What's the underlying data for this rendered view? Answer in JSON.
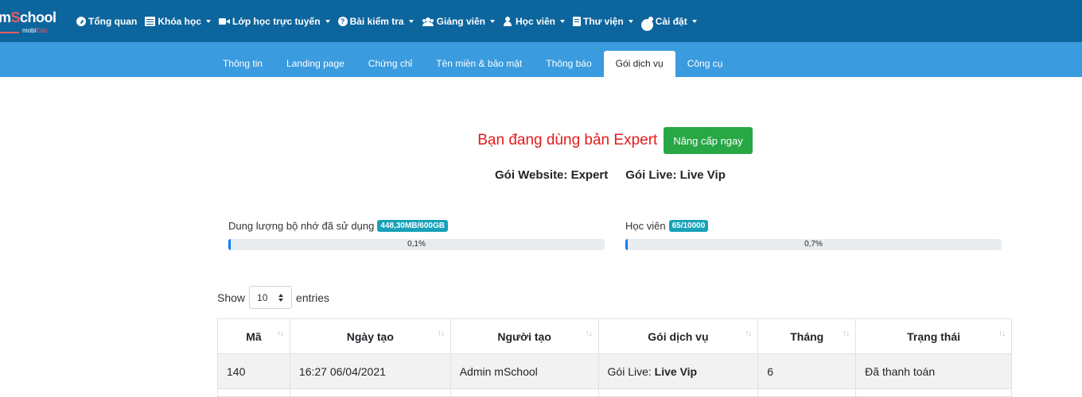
{
  "brand": {
    "name_prefix": "m",
    "name_highlight": "S",
    "name_suffix": "chool",
    "sub_prefix": "mobi",
    "sub_highlight": "Edu"
  },
  "topnav": {
    "items": [
      {
        "label": "Tổng quan",
        "icon": "dashboard-icon",
        "dropdown": false
      },
      {
        "label": "Khóa học",
        "icon": "list-icon",
        "dropdown": true
      },
      {
        "label": "Lớp học trực tuyến",
        "icon": "video-icon",
        "dropdown": true
      },
      {
        "label": "Bài kiểm tra",
        "icon": "question-circle-icon",
        "dropdown": true
      },
      {
        "label": "Giảng viên",
        "icon": "users-icon",
        "dropdown": true
      },
      {
        "label": "Học viên",
        "icon": "user-icon",
        "dropdown": true
      },
      {
        "label": "Thư viện",
        "icon": "book-icon",
        "dropdown": true
      },
      {
        "label": "Cài đặt",
        "icon": "cogs-icon",
        "dropdown": true
      }
    ]
  },
  "subnav": {
    "tabs": [
      "Thông tin",
      "Landing page",
      "Chứng chỉ",
      "Tên miền & bảo mật",
      "Thông báo",
      "Gói dịch vụ",
      "Công cụ"
    ],
    "active_tab": "Gói dịch vụ"
  },
  "plan": {
    "current_text": "Bạn đang dùng bản Expert",
    "upgrade_button": "Nâng cấp ngay",
    "website_package": "Gói Website: Expert",
    "live_package": "Gói Live: Live Vip"
  },
  "stats": {
    "storage": {
      "label": "Dung lượng bộ nhớ đã sử dụng",
      "badge": "448,30MB/600GB",
      "percent_text": "0,1%",
      "percent": 0.1
    },
    "students": {
      "label": "Học viên",
      "badge": "65/10000",
      "percent_text": "0,7%",
      "percent": 0.7
    }
  },
  "length_control": {
    "show": "Show",
    "value": "10",
    "entries": "entries"
  },
  "table": {
    "headers": [
      "Mã",
      "Ngày tạo",
      "Người tạo",
      "Gói dịch vụ",
      "Tháng",
      "Trạng thái"
    ],
    "sort_icon": "sort-arrows-icon",
    "rows": [
      {
        "ma": "140",
        "ngay_tao": "16:27 06/04/2021",
        "nguoi_tao": "Admin mSchool",
        "goi_prefix": "Gói Live: ",
        "goi_value": "Live Vip",
        "thang": "6",
        "trang_thai": "Đã thanh toán"
      }
    ]
  },
  "colors": {
    "topnav": "#0d659d",
    "subnav": "#3a9bde",
    "plan_text": "#e31b1b",
    "upgrade_button": "#28a745",
    "badge": "#17a2b8",
    "progress": "#007bff"
  }
}
